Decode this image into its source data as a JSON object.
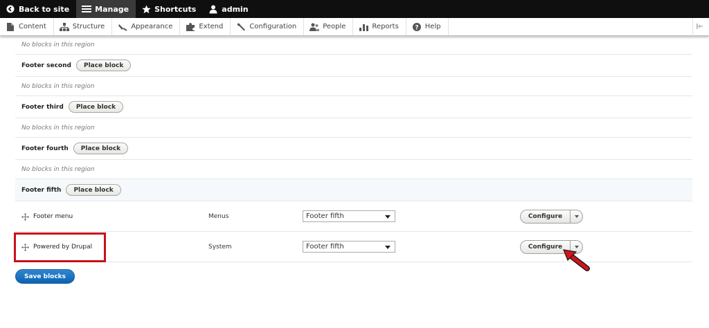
{
  "toolbar": {
    "items": [
      {
        "label": "Back to site",
        "icon": "back-circle-icon"
      },
      {
        "label": "Manage",
        "icon": "menu-icon",
        "active": true
      },
      {
        "label": "Shortcuts",
        "icon": "star-icon"
      },
      {
        "label": "admin",
        "icon": "user-icon"
      }
    ]
  },
  "tray": {
    "items": [
      {
        "label": "Content",
        "icon": "file-icon"
      },
      {
        "label": "Structure",
        "icon": "sitemap-icon"
      },
      {
        "label": "Appearance",
        "icon": "paintbrush-icon"
      },
      {
        "label": "Extend",
        "icon": "puzzle-icon"
      },
      {
        "label": "Configuration",
        "icon": "wrench-icon"
      },
      {
        "label": "People",
        "icon": "people-icon"
      },
      {
        "label": "Reports",
        "icon": "bar-chart-icon"
      },
      {
        "label": "Help",
        "icon": "help-icon"
      }
    ]
  },
  "regions": {
    "empty_text": "No blocks in this region",
    "place_block_label": "Place block",
    "footer_second": "Footer second",
    "footer_third": "Footer third",
    "footer_fourth": "Footer fourth",
    "footer_fifth": "Footer fifth"
  },
  "blocks": [
    {
      "name": "Footer menu",
      "category": "Menus",
      "region": "Footer fifth",
      "configure_label": "Configure"
    },
    {
      "name": "Powered by Drupal",
      "category": "System",
      "region": "Footer fifth",
      "configure_label": "Configure"
    }
  ],
  "save_label": "Save blocks",
  "colors": {
    "accent": "#0a64b2",
    "annotation": "#c8111a",
    "toolbar_bg": "#0f0f0f"
  }
}
